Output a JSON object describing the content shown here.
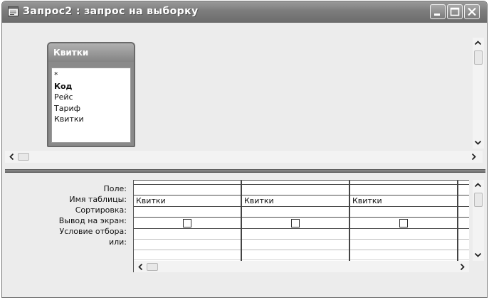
{
  "window": {
    "title": "Запрос2 : запрос на выборку",
    "icon": "query-icon",
    "controls": [
      "minimize-icon",
      "maximize-icon",
      "close-icon"
    ]
  },
  "table": {
    "title": "Квитки",
    "fields": [
      "*",
      "Код",
      "Рейс",
      "Тариф",
      "Квитки"
    ],
    "primary_key_index": 1
  },
  "grid": {
    "row_labels": [
      "Поле:",
      "Имя таблицы:",
      "Сортировка:",
      "Вывод на экран:",
      "Условие отбора:",
      "или:"
    ],
    "columns": [
      {
        "field": "",
        "table": "Квитки",
        "sort": "",
        "show": false,
        "criteria": "",
        "or": ""
      },
      {
        "field": "",
        "table": "Квитки",
        "sort": "",
        "show": false,
        "criteria": "",
        "or": ""
      },
      {
        "field": "",
        "table": "Квитки",
        "sort": "",
        "show": false,
        "criteria": "",
        "or": ""
      }
    ]
  },
  "colors": {
    "titlebar": "#7c7c7c",
    "pane_background": "#ececec",
    "grid_background": "#ffffff"
  }
}
